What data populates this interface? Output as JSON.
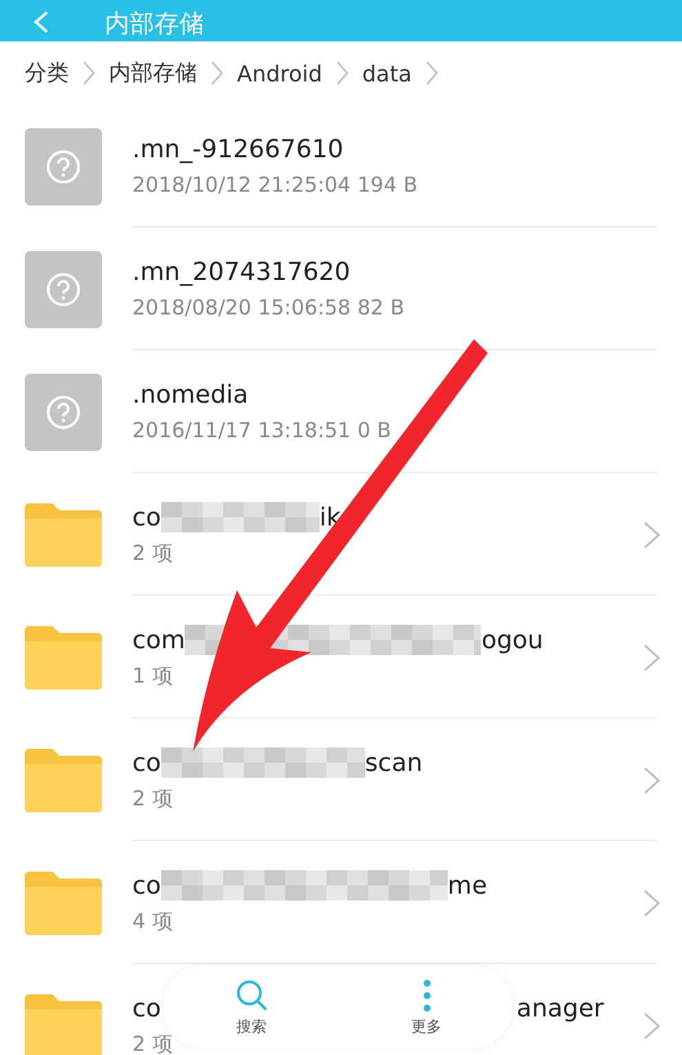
{
  "app_bar": {
    "title": "内部存储"
  },
  "breadcrumb": [
    "分类",
    "内部存储",
    "Android",
    "data"
  ],
  "items": [
    {
      "kind": "file",
      "name": ".mn_-912667610",
      "detail": "2018/10/12 21:25:04 194 B"
    },
    {
      "kind": "file",
      "name": ".mn_2074317620",
      "detail": "2018/08/20 15:06:58 82 B"
    },
    {
      "kind": "file",
      "name": ".nomedia",
      "detail": "2016/11/17 13:18:51 0 B"
    },
    {
      "kind": "folder",
      "name_start": "co",
      "name_end": "ik",
      "detail": "2 项"
    },
    {
      "kind": "folder",
      "name_start": "com",
      "name_end": "ogou",
      "detail": "1 项"
    },
    {
      "kind": "folder",
      "name_start": "co",
      "name_end": "scan",
      "detail": "2 项"
    },
    {
      "kind": "folder",
      "name_start": "co",
      "name_end": "me",
      "detail": "4 项"
    },
    {
      "kind": "folder",
      "name_start": "co",
      "name_end": "anager",
      "detail": "2 项"
    }
  ],
  "bottom_bar": [
    {
      "kind": "search",
      "label": "搜索"
    },
    {
      "kind": "more",
      "label": "更多"
    }
  ]
}
